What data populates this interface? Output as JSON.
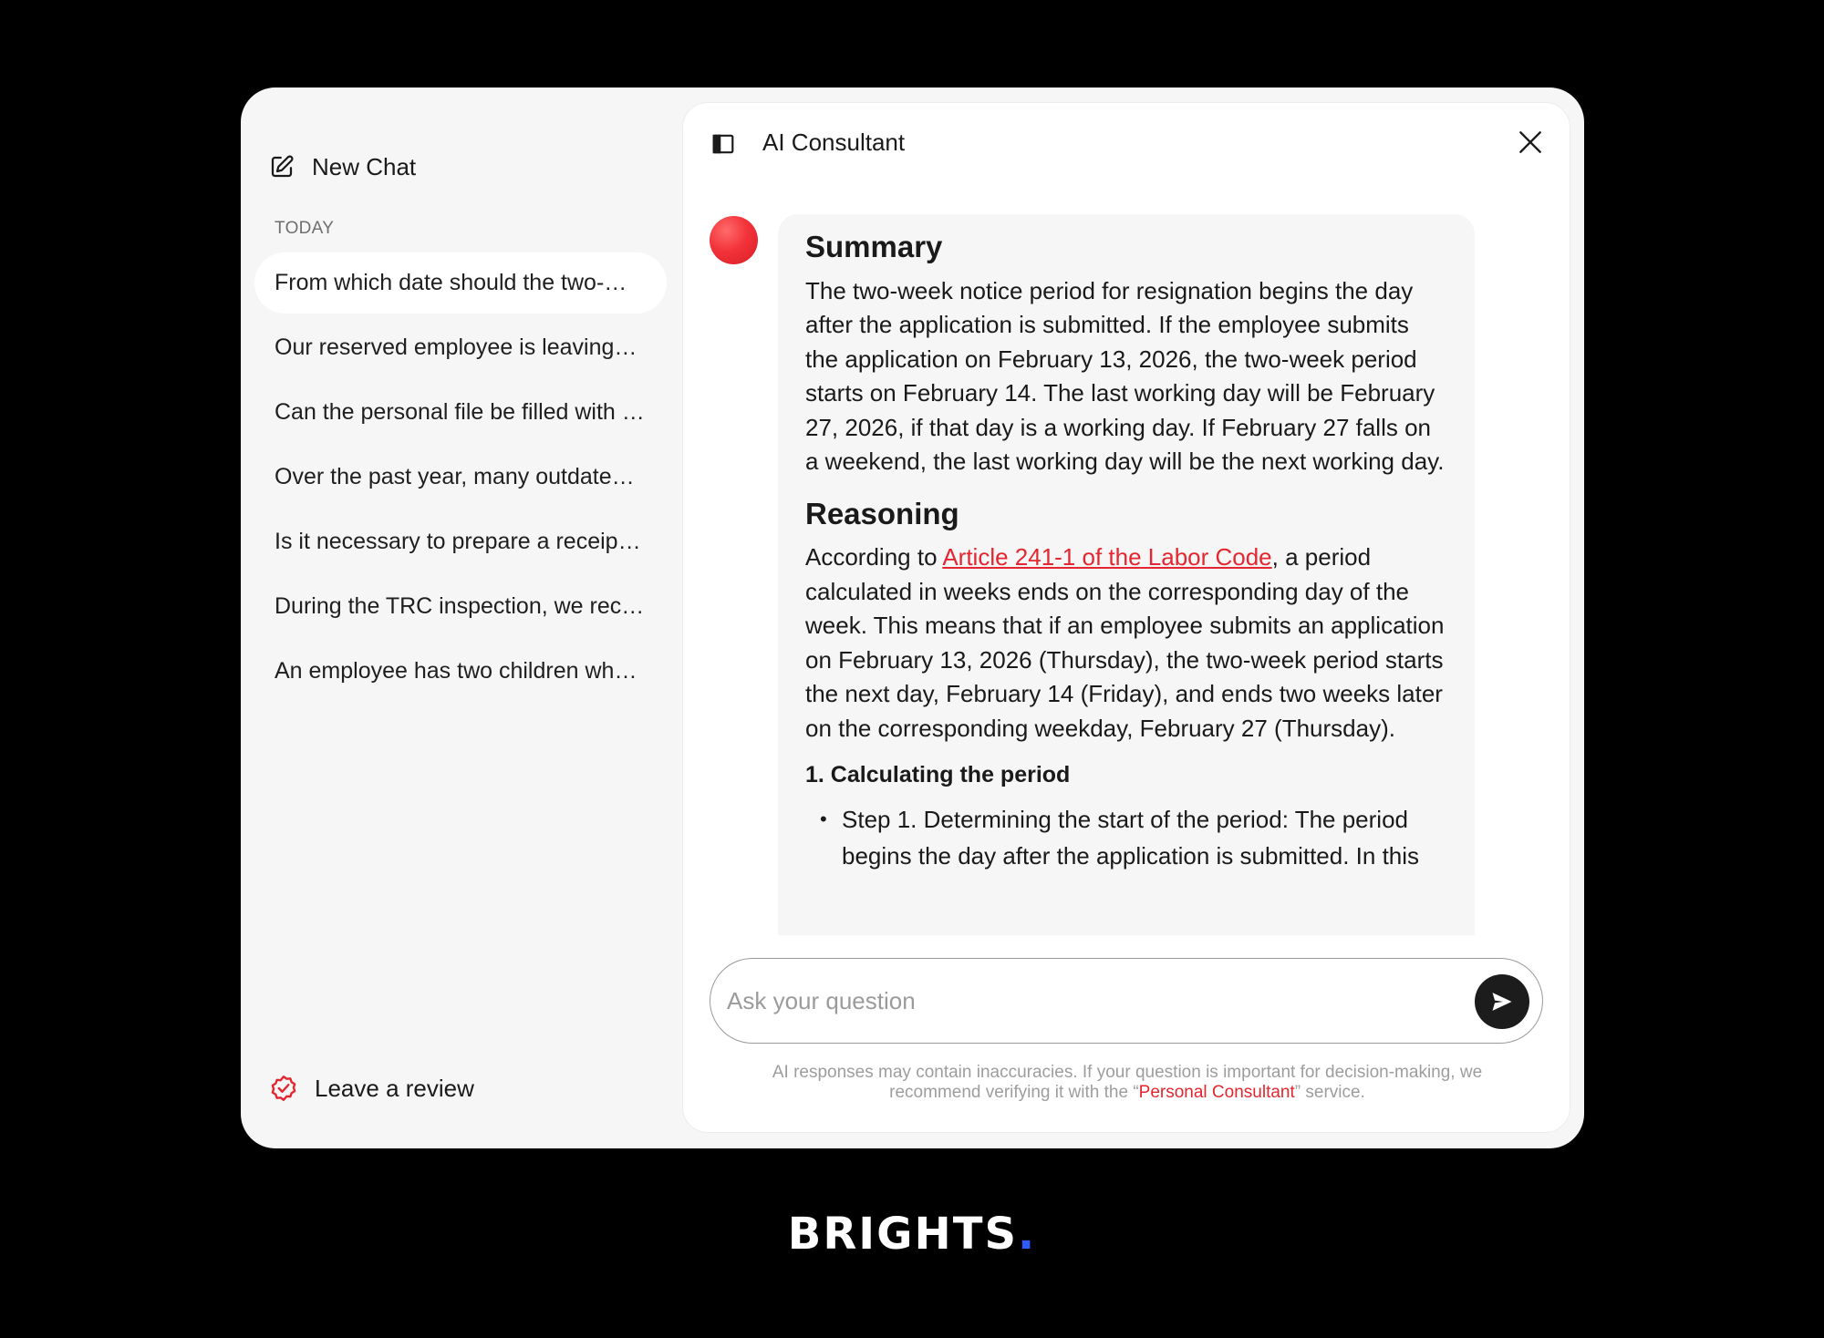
{
  "sidebar": {
    "new_chat_label": "New Chat",
    "section_label": "TODAY",
    "items": [
      {
        "label": "From which date should the two-week notice period be calculated?"
      },
      {
        "label": "Our reserved employee is leaving the company"
      },
      {
        "label": "Can the personal file be filled with copies of documents?"
      },
      {
        "label": "Over the past year, many outdated documents have accumulated"
      },
      {
        "label": "Is it necessary to prepare a receipt for the employee?"
      },
      {
        "label": "During the TRC inspection, we received a request"
      },
      {
        "label": "An employee has two children who need care"
      }
    ],
    "review_label": "Leave a review"
  },
  "header": {
    "title": "AI Consultant"
  },
  "message": {
    "summary_heading": "Summary",
    "summary_text": "The two-week notice period for resignation begins the day after the application is submitted. If the employee submits the application on February 13, 2026, the two-week period starts on February 14. The last working day will be February 27, 2026, if that day is a working day. If February 27 falls on a weekend, the last working day will be the next working day.",
    "reasoning_heading": "Reasoning",
    "reasoning_prefix": "According to ",
    "reasoning_link": "Article 241-1 of the Labor Code",
    "reasoning_suffix": ", a period calculated in weeks ends on the corresponding day of the week. This means that if an employee submits an application on February 13, 2026 (Thursday), the two-week period starts the next day, February 14 (Friday), and ends two weeks later on the corresponding weekday, February 27 (Thursday).",
    "subheading": "1. Calculating the period",
    "bullets": [
      "Step 1. Determining the start of the period: The period begins the day after the application is submitted. In this"
    ]
  },
  "input": {
    "placeholder": "Ask your question"
  },
  "disclaimer": {
    "prefix": "AI responses may contain inaccuracies. If your question is important for decision-making, we recommend verifying it with the “",
    "link": "Personal Consultant",
    "suffix": "” service."
  },
  "brand": {
    "name": "BRIGHTS",
    "dot": ".",
    "dot_color": "#2f5bff"
  },
  "colors": {
    "accent": "#e3262f",
    "background": "#000000",
    "sidebar": "#f6f6f6",
    "send_button": "#1c1c1c"
  }
}
